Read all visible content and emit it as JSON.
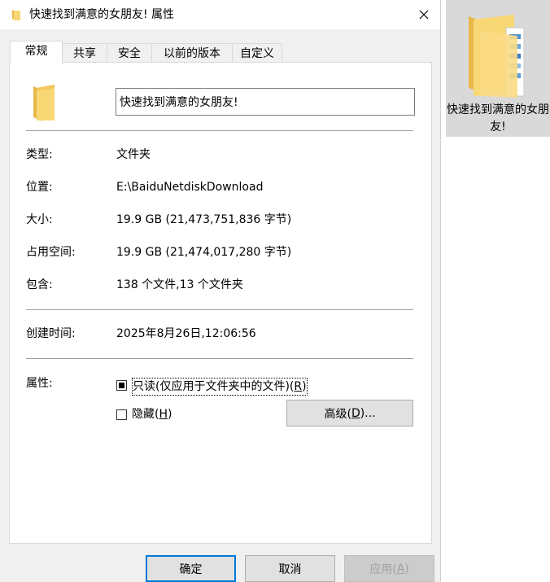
{
  "window": {
    "title": "快速找到满意的女朋友!  属性",
    "close_symbol": "✕"
  },
  "tabs": [
    {
      "label": "常规",
      "active": true
    },
    {
      "label": "共享",
      "active": false
    },
    {
      "label": "安全",
      "active": false
    },
    {
      "label": "以前的版本",
      "active": false
    },
    {
      "label": "自定义",
      "active": false
    }
  ],
  "general": {
    "folder_name": "快速找到满意的女朋友!",
    "type_label": "类型:",
    "type_value": "文件夹",
    "location_label": "位置:",
    "location_value": "E:\\BaiduNetdiskDownload",
    "size_label": "大小:",
    "size_value": "19.9 GB (21,473,751,836 字节)",
    "disk_size_label": "占用空间:",
    "disk_size_value": "19.9 GB (21,474,017,280 字节)",
    "contains_label": "包含:",
    "contains_value": "138 个文件,13 个文件夹",
    "created_label": "创建时间:",
    "created_value": "2025年8月26日,12:06:56",
    "attributes_label": "属性:",
    "readonly_label_pre": "只读(仅应用于文件夹中的文件)(",
    "readonly_key": "R",
    "readonly_label_post": ")",
    "readonly_state": "indeterminate",
    "hidden_label_pre": "隐藏(",
    "hidden_key": "H",
    "hidden_label_post": ")",
    "hidden_checked": false,
    "advanced_pre": "高级(",
    "advanced_key": "D",
    "advanced_post": ")..."
  },
  "footer": {
    "ok": "确定",
    "cancel": "取消",
    "apply_pre": "应用(",
    "apply_key": "A",
    "apply_post": ")"
  },
  "desktop": {
    "folder_label": "快速找到满意的女朋友!"
  },
  "colors": {
    "folder_yellow": "#f8d775",
    "folder_dark": "#e8b84a",
    "accent": "#0078d7"
  }
}
